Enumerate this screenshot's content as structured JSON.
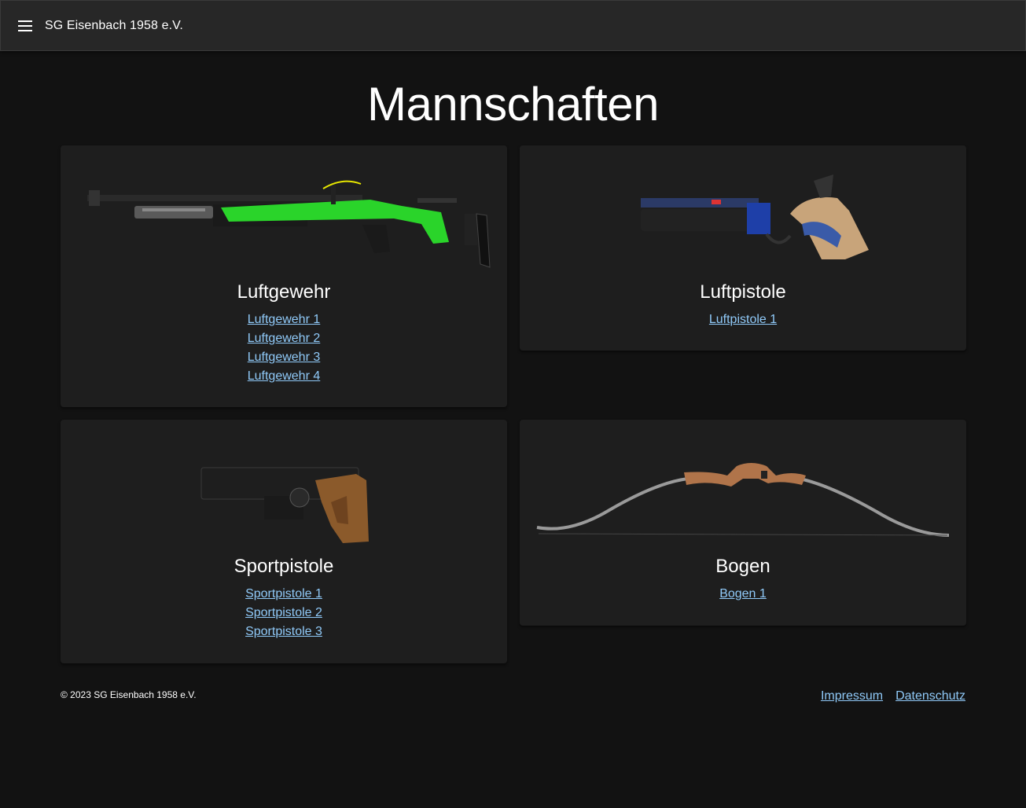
{
  "header": {
    "brand": "SG Eisenbach 1958 e.V.",
    "menu_icon": "hamburger-menu-icon"
  },
  "page_title": "Mannschaften",
  "teams": {
    "luftgewehr": {
      "title": "Luftgewehr",
      "image": "air-rifle-image",
      "links": [
        "Luftgewehr 1",
        "Luftgewehr 2",
        "Luftgewehr 3",
        "Luftgewehr 4"
      ]
    },
    "luftpistole": {
      "title": "Luftpistole",
      "image": "air-pistol-image",
      "links": [
        "Luftpistole 1"
      ]
    },
    "sportpistole": {
      "title": "Sportpistole",
      "image": "sport-pistol-image",
      "links": [
        "Sportpistole 1",
        "Sportpistole 2",
        "Sportpistole 3"
      ]
    },
    "bogen": {
      "title": "Bogen",
      "image": "recurve-bow-image",
      "links": [
        "Bogen 1"
      ]
    }
  },
  "footer": {
    "copyright": "© 2023 SG Eisenbach 1958 e.V.",
    "links": [
      "Impressum",
      "Datenschutz"
    ]
  },
  "colors": {
    "background": "#121212",
    "appbar": "#272727",
    "card": "#1e1e1e",
    "link": "#90caf9"
  }
}
